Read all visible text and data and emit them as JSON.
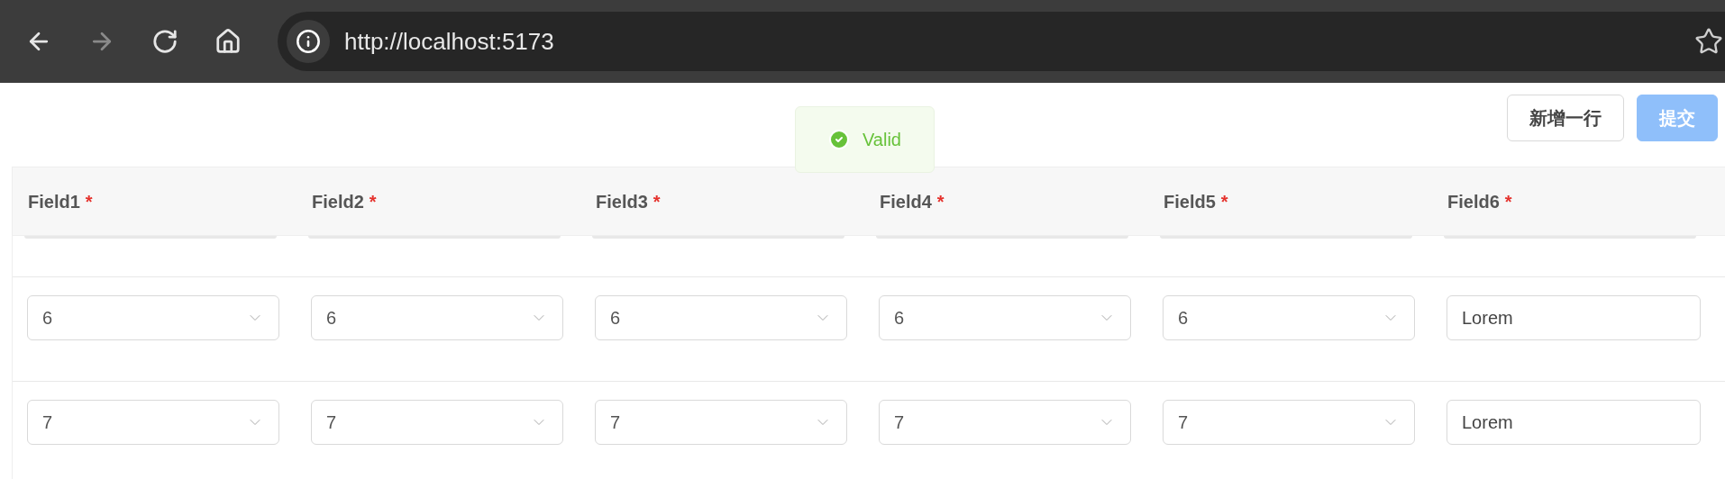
{
  "browser": {
    "nav": [
      {
        "kind": "back",
        "disabled": false
      },
      {
        "kind": "forward",
        "disabled": true
      },
      {
        "kind": "reload",
        "disabled": false
      },
      {
        "kind": "home",
        "disabled": false
      }
    ],
    "url": "http://localhost:5173"
  },
  "toolbar": {
    "buttons": [
      {
        "label": "新增一行",
        "kind": "default",
        "disabled": false
      },
      {
        "label": "提交",
        "kind": "primary",
        "disabled": true
      }
    ]
  },
  "toast": {
    "kind": "success",
    "text": "Valid"
  },
  "table": {
    "columns": [
      {
        "label": "Field1",
        "required_mark": "*"
      },
      {
        "label": "Field2",
        "required_mark": "*"
      },
      {
        "label": "Field3",
        "required_mark": "*"
      },
      {
        "label": "Field4",
        "required_mark": "*"
      },
      {
        "label": "Field5",
        "required_mark": "*"
      },
      {
        "label": "Field6",
        "required_mark": "*"
      }
    ],
    "rows": [
      {
        "cells": [
          {
            "kind": "select",
            "value": "6"
          },
          {
            "kind": "select",
            "value": "6"
          },
          {
            "kind": "select",
            "value": "6"
          },
          {
            "kind": "select",
            "value": "6"
          },
          {
            "kind": "select",
            "value": "6"
          },
          {
            "kind": "input",
            "value": "Lorem"
          }
        ]
      },
      {
        "cells": [
          {
            "kind": "select",
            "value": "7"
          },
          {
            "kind": "select",
            "value": "7"
          },
          {
            "kind": "select",
            "value": "7"
          },
          {
            "kind": "select",
            "value": "7"
          },
          {
            "kind": "select",
            "value": "7"
          },
          {
            "kind": "input",
            "value": "Lorem"
          }
        ]
      }
    ]
  }
}
